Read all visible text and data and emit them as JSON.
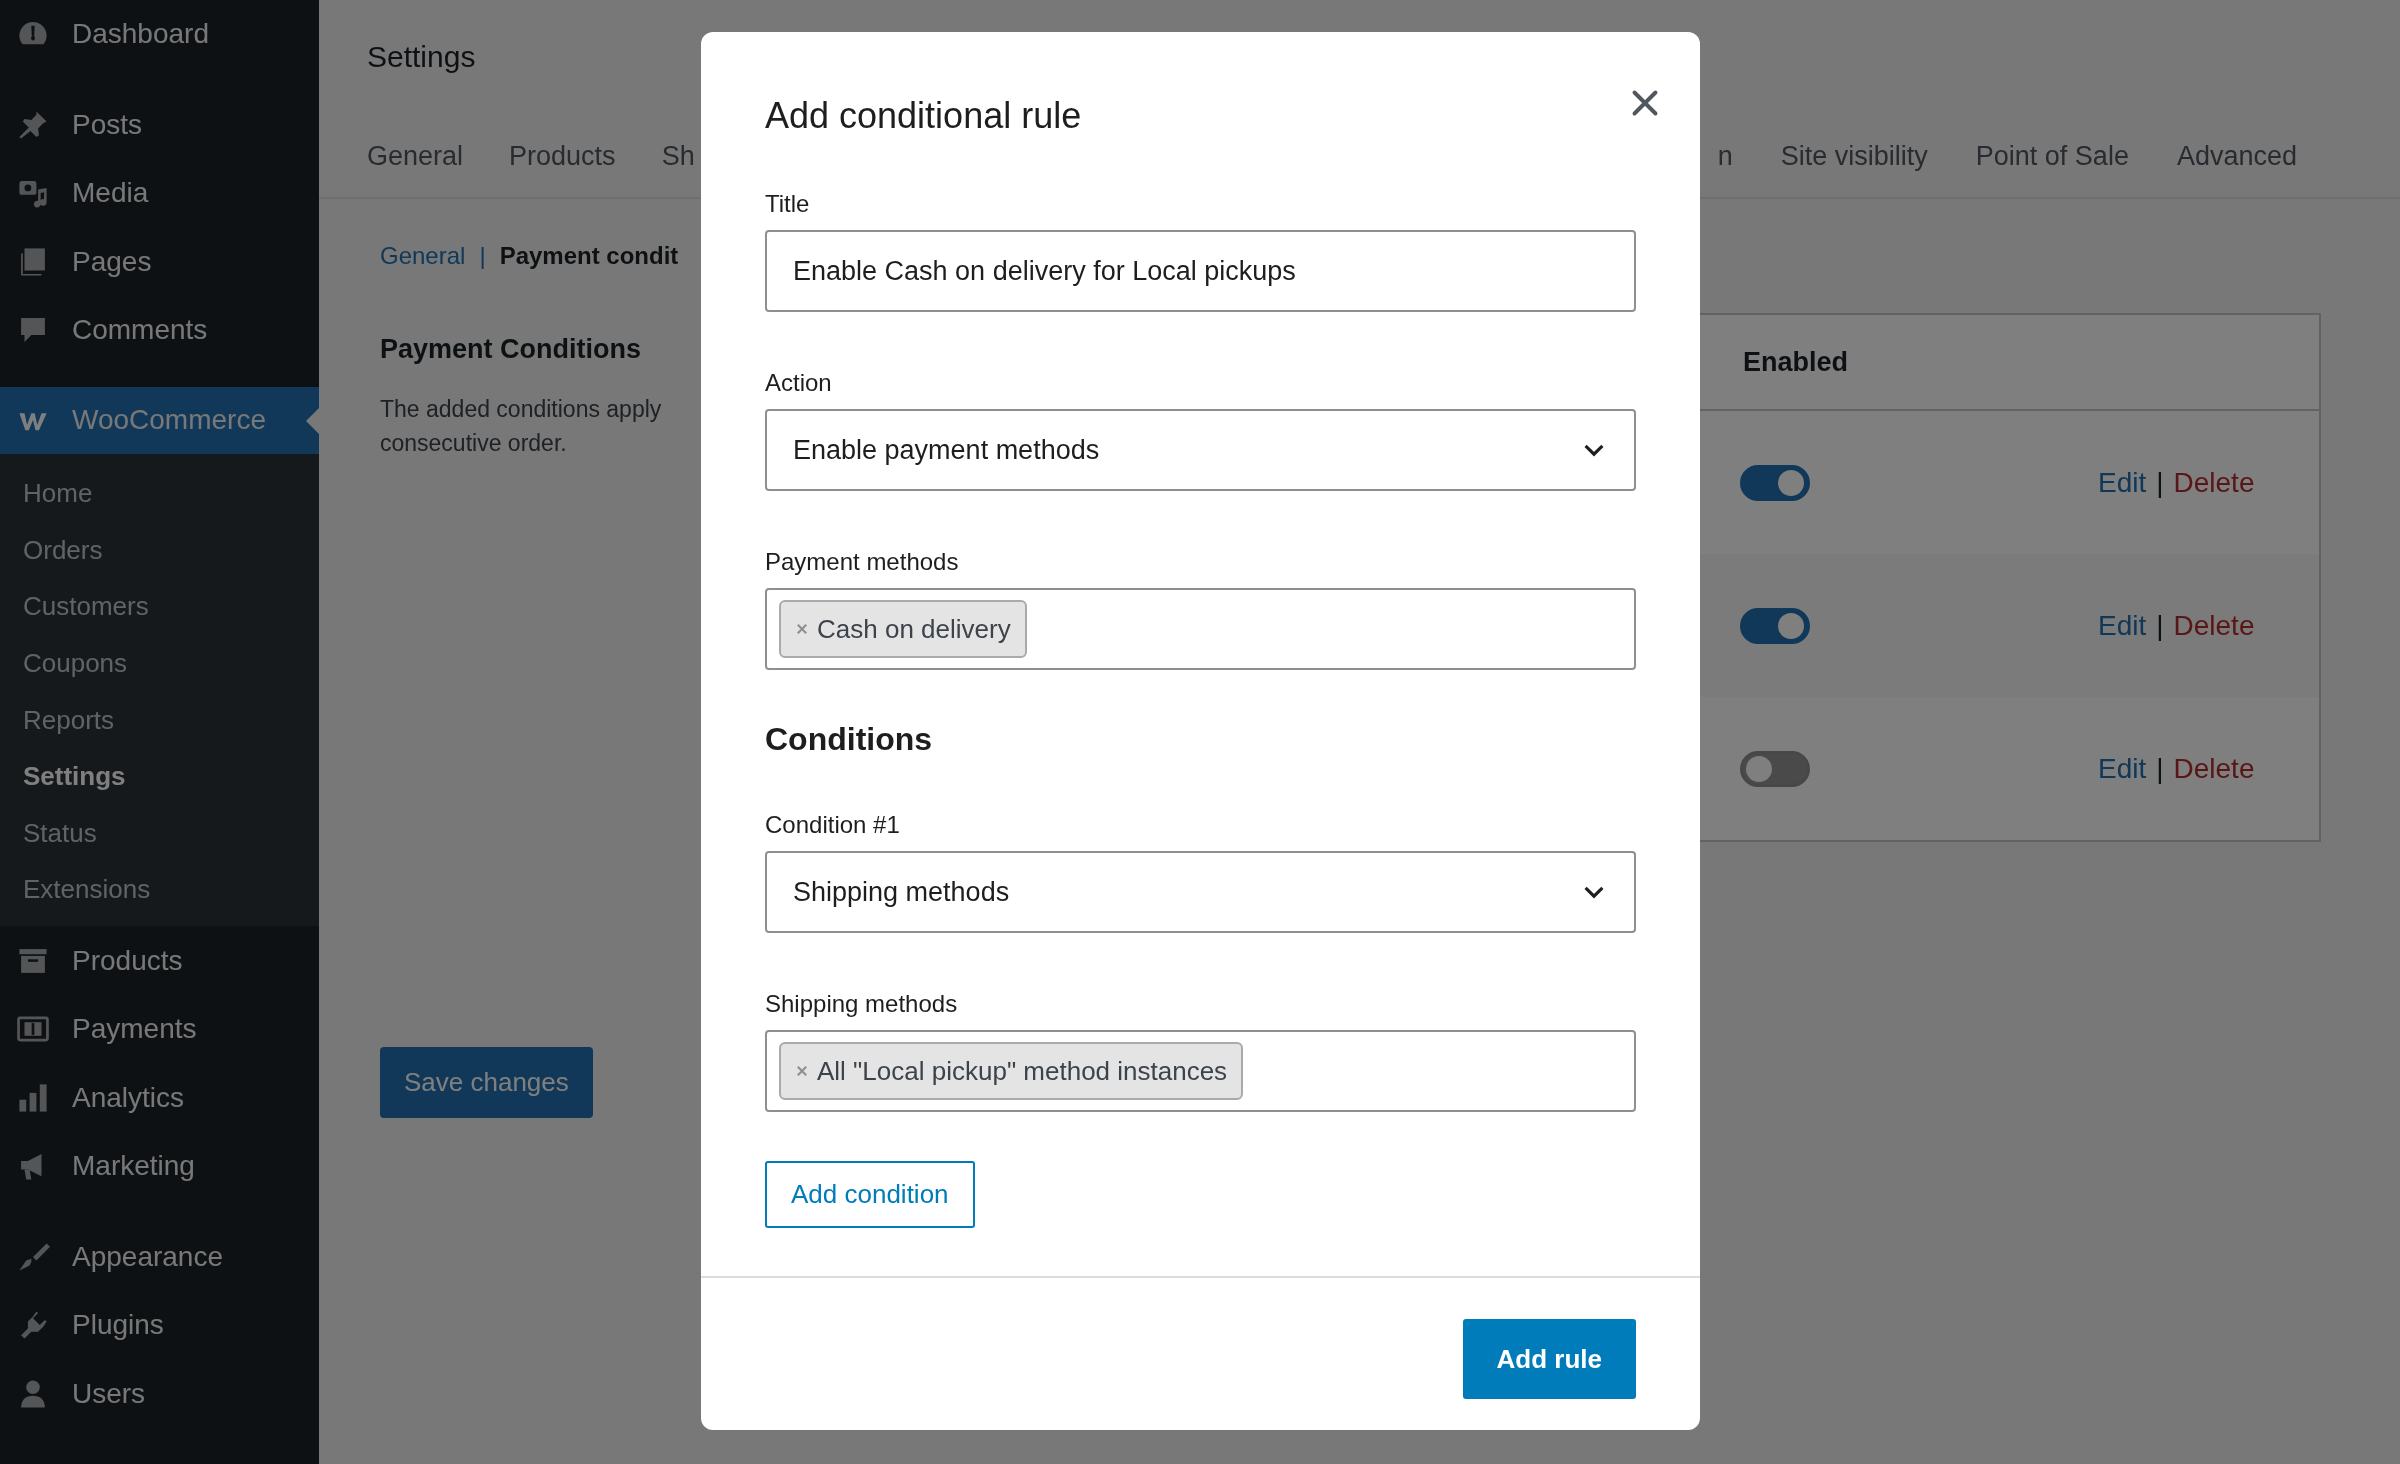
{
  "sidebar": {
    "groups": [
      [
        {
          "label": "Dashboard",
          "selected": false
        }
      ],
      [
        {
          "label": "Posts",
          "selected": false
        },
        {
          "label": "Media",
          "selected": false
        },
        {
          "label": "Pages",
          "selected": false
        },
        {
          "label": "Comments",
          "selected": false
        }
      ],
      [
        {
          "label": "WooCommerce",
          "selected": true,
          "children": [
            {
              "label": "Home",
              "selected": false
            },
            {
              "label": "Orders",
              "selected": false
            },
            {
              "label": "Customers",
              "selected": false
            },
            {
              "label": "Coupons",
              "selected": false
            },
            {
              "label": "Reports",
              "selected": false
            },
            {
              "label": "Settings",
              "selected": true
            },
            {
              "label": "Status",
              "selected": false
            },
            {
              "label": "Extensions",
              "selected": false
            }
          ]
        },
        {
          "label": "Products",
          "selected": false
        },
        {
          "label": "Payments",
          "selected": false
        },
        {
          "label": "Analytics",
          "selected": false
        },
        {
          "label": "Marketing",
          "selected": false
        }
      ],
      [
        {
          "label": "Appearance",
          "selected": false
        },
        {
          "label": "Plugins",
          "selected": false
        },
        {
          "label": "Users",
          "selected": false
        }
      ]
    ]
  },
  "page": {
    "title": "Settings",
    "tabs_left": [
      {
        "label": "General",
        "selected": false
      },
      {
        "label": "Products",
        "selected": false
      },
      {
        "label": "Sh",
        "selected": false
      }
    ],
    "tabs_right": [
      {
        "label": "n",
        "selected": false
      },
      {
        "label": "Site visibility",
        "selected": false
      },
      {
        "label": "Point of Sale",
        "selected": false
      },
      {
        "label": "Advanced",
        "selected": false
      }
    ],
    "breadcrumb": [
      {
        "label": "General",
        "kind": "link"
      },
      {
        "label": "|",
        "kind": "separator"
      },
      {
        "label": "Payment condit",
        "kind": "current"
      }
    ],
    "heading": "Payment Conditions",
    "description_lines": [
      "The added conditions apply",
      "consecutive order."
    ],
    "save_button": "Save changes",
    "table": {
      "columns": [
        "Enabled"
      ],
      "rows": [
        {
          "enabled": true,
          "edit": "Edit",
          "separator": "|",
          "delete": "Delete"
        },
        {
          "enabled": true,
          "edit": "Edit",
          "separator": "|",
          "delete": "Delete"
        },
        {
          "enabled": false,
          "edit": "Edit",
          "separator": "|",
          "delete": "Delete"
        }
      ]
    }
  },
  "modal": {
    "title": "Add conditional rule",
    "fields": [
      {
        "label": "Title",
        "kind": "text",
        "value": "Enable Cash on delivery for Local pickups"
      },
      {
        "label": "Action",
        "kind": "select",
        "value": "Enable payment methods"
      },
      {
        "label": "Payment methods",
        "kind": "tokens",
        "tokens": [
          "Cash on delivery"
        ]
      }
    ],
    "conditions": {
      "heading": "Conditions",
      "fields": [
        {
          "label": "Condition #1",
          "kind": "select",
          "value": "Shipping methods"
        },
        {
          "label": "Shipping methods",
          "kind": "tokens",
          "tokens": [
            "All \"Local pickup\" method instances"
          ]
        }
      ]
    },
    "add_condition": "Add condition",
    "add_rule": "Add rule"
  }
}
